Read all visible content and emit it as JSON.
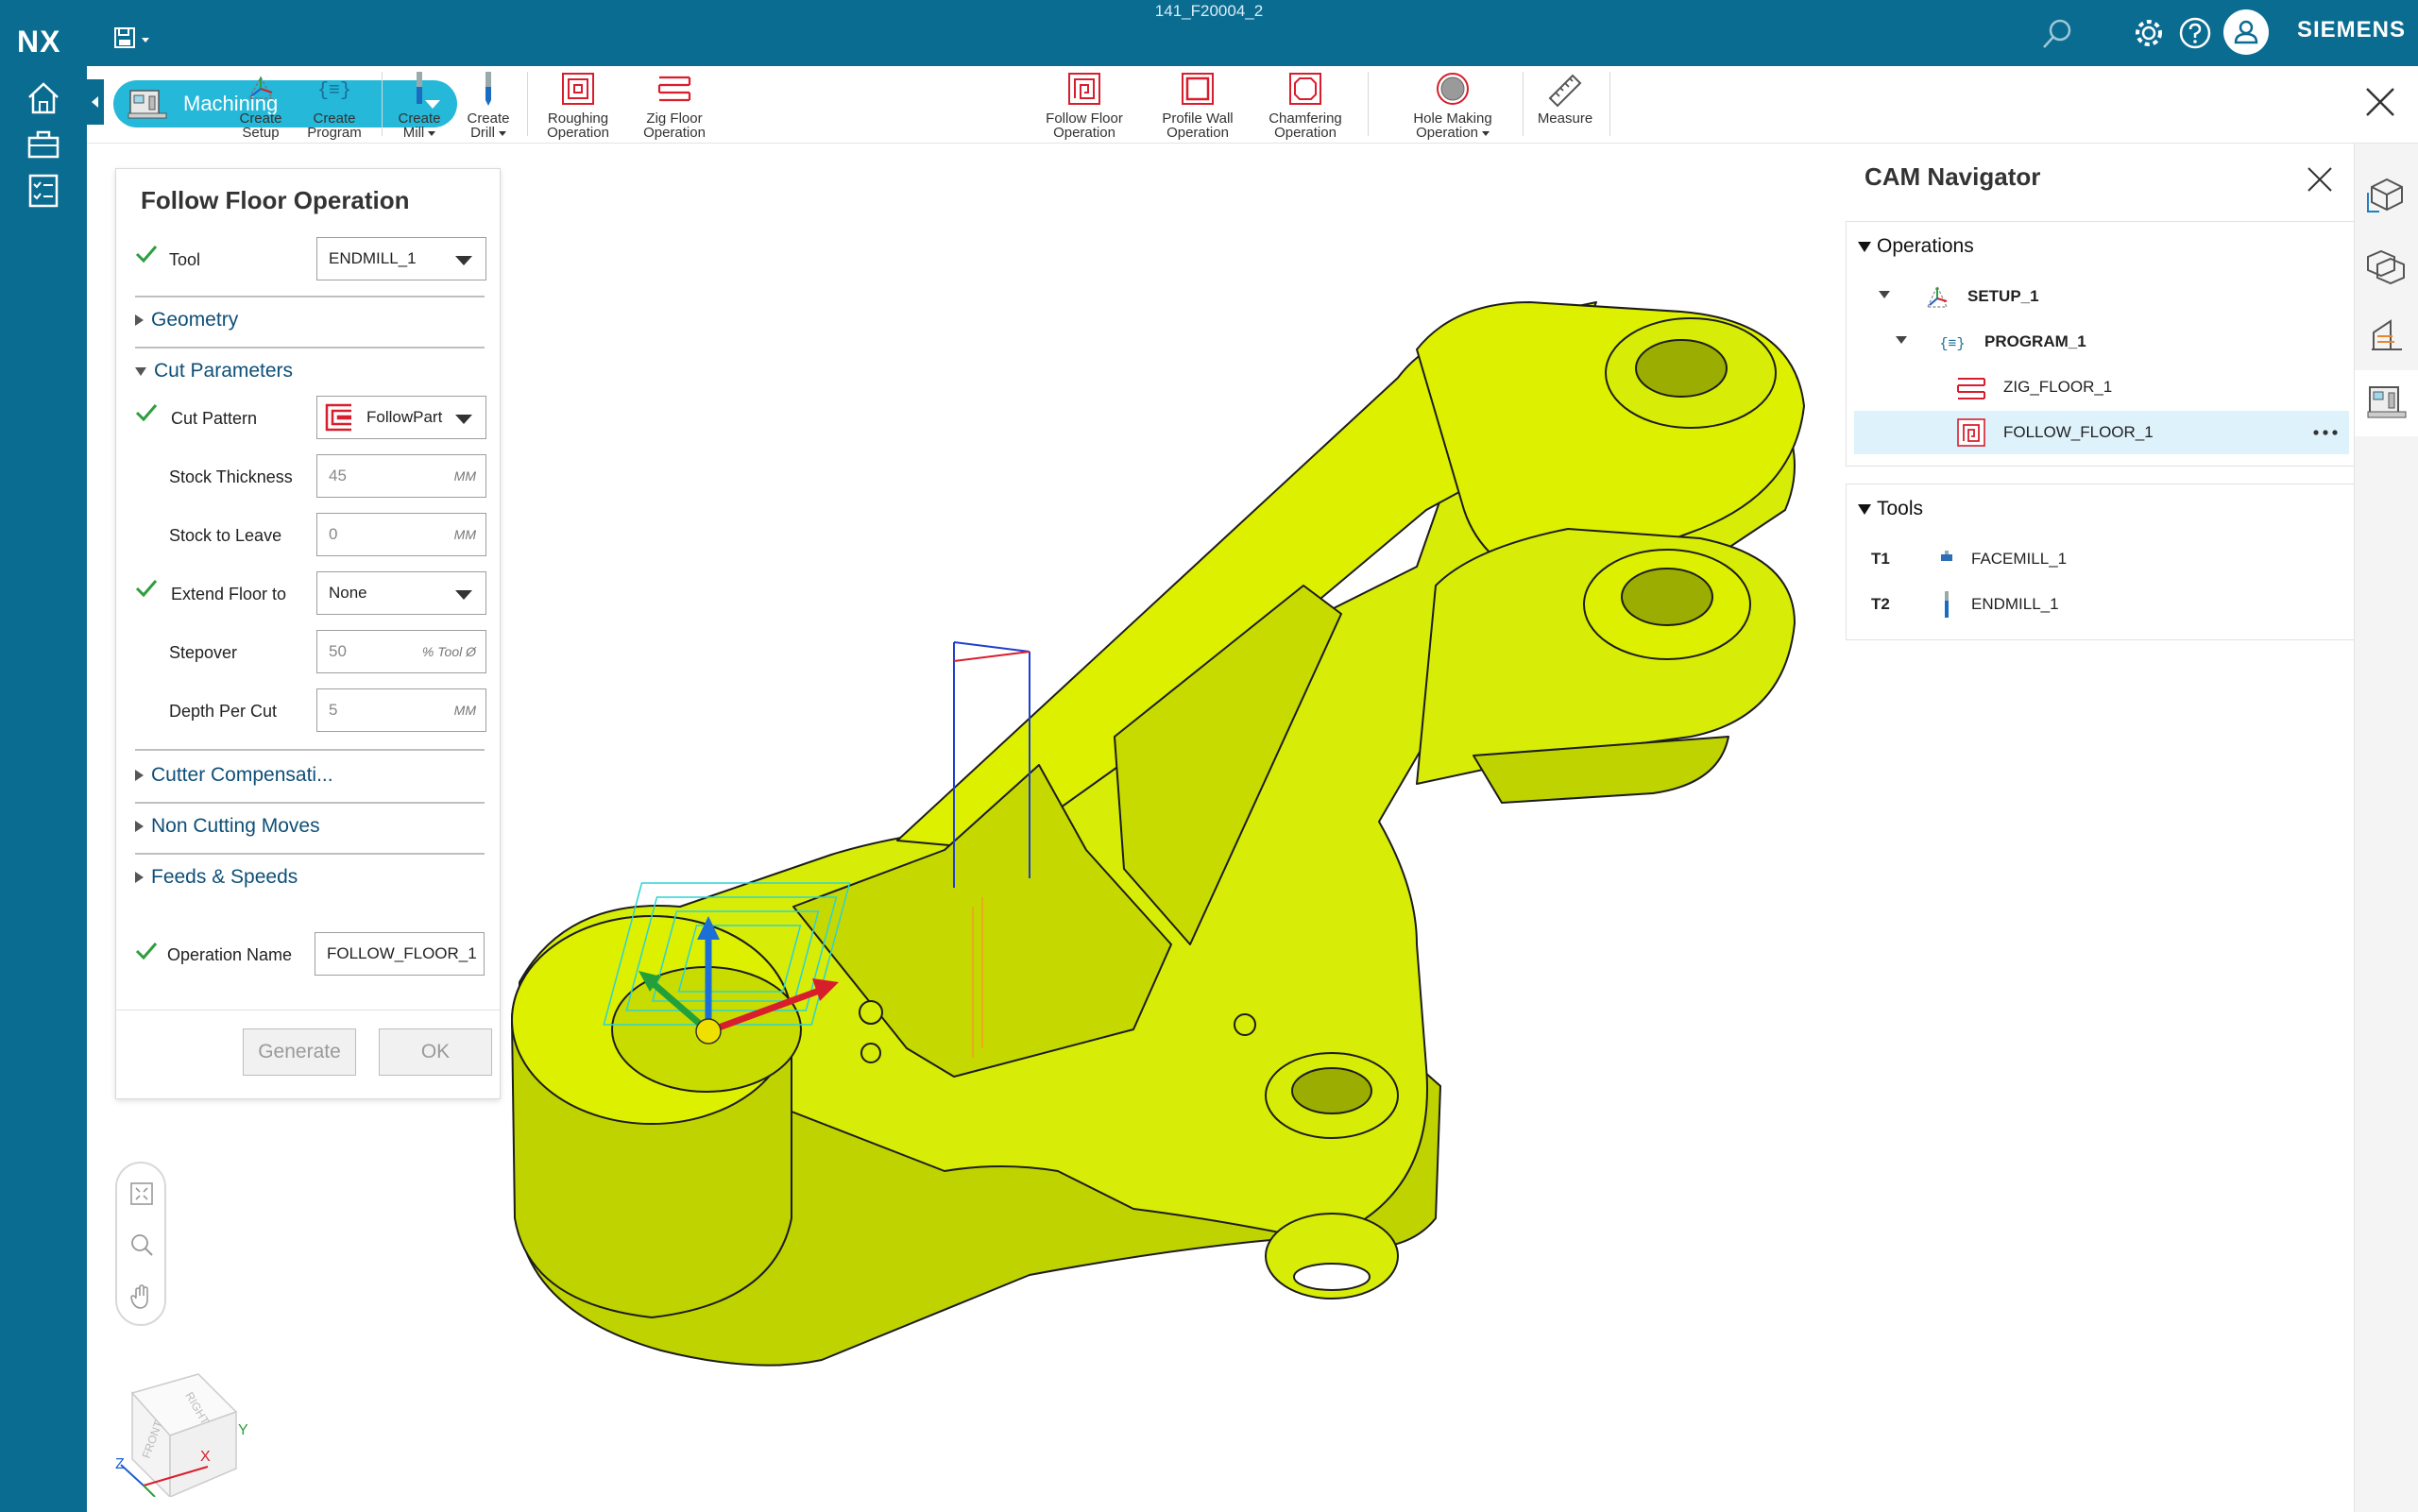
{
  "app": {
    "logo": "NX",
    "document_title": "141_F20004_2",
    "brand": "SIEMENS"
  },
  "ribbon": {
    "application": "Machining",
    "buttons": [
      {
        "line1": "Create",
        "line2": "Setup",
        "icon": "setup-icon"
      },
      {
        "line1": "Create",
        "line2": "Program",
        "icon": "program-icon"
      },
      {
        "line1": "Create",
        "line2": "Mill",
        "icon": "mill-icon",
        "dropdown": true
      },
      {
        "line1": "Create",
        "line2": "Drill",
        "icon": "drill-icon",
        "dropdown": true
      },
      {
        "line1": "Roughing",
        "line2": "Operation",
        "icon": "roughing-icon"
      },
      {
        "line1": "Zig Floor",
        "line2": "Operation",
        "icon": "zig-floor-icon"
      },
      {
        "line1": "Follow Floor",
        "line2": "Operation",
        "icon": "follow-floor-icon"
      },
      {
        "line1": "Profile Wall",
        "line2": "Operation",
        "icon": "profile-wall-icon"
      },
      {
        "line1": "Chamfering",
        "line2": "Operation",
        "icon": "chamfering-icon"
      },
      {
        "line1": "Hole Making",
        "line2": "Operation",
        "icon": "hole-making-icon",
        "dropdown": true
      },
      {
        "line1": "Measure",
        "line2": "",
        "icon": "ruler-icon"
      }
    ]
  },
  "operation_panel": {
    "title": "Follow Floor Operation",
    "tool": {
      "label": "Tool",
      "value": "ENDMILL_1"
    },
    "sections": {
      "geometry": "Geometry",
      "cut_parameters": "Cut Parameters",
      "cutter_compensation": "Cutter Compensati...",
      "non_cutting_moves": "Non Cutting Moves",
      "feeds_speeds": "Feeds & Speeds"
    },
    "cut_pattern": {
      "label": "Cut Pattern",
      "value": "FollowPart"
    },
    "stock_thickness": {
      "label": "Stock Thickness",
      "value": "45",
      "unit": "MM"
    },
    "stock_to_leave": {
      "label": "Stock to Leave",
      "value": "0",
      "unit": "MM"
    },
    "extend_floor_to": {
      "label": "Extend Floor to",
      "value": "None"
    },
    "stepover": {
      "label": "Stepover",
      "value": "50",
      "unit": "% Tool Ø"
    },
    "depth_per_cut": {
      "label": "Depth Per Cut",
      "value": "5",
      "unit": "MM"
    },
    "operation_name": {
      "label": "Operation Name",
      "value": "FOLLOW_FLOOR_1"
    },
    "buttons": {
      "generate": "Generate",
      "ok": "OK"
    }
  },
  "cam_navigator": {
    "title": "CAM Navigator",
    "operations_header": "Operations",
    "operations": [
      {
        "label": "SETUP_1",
        "level": 0,
        "bold": true
      },
      {
        "label": "PROGRAM_1",
        "level": 1,
        "bold": true
      },
      {
        "label": "ZIG_FLOOR_1",
        "level": 2,
        "bold": false
      },
      {
        "label": "FOLLOW_FLOOR_1",
        "level": 2,
        "bold": false,
        "selected": true
      }
    ],
    "tools_header": "Tools",
    "tools": [
      {
        "id": "T1",
        "name": "FACEMILL_1"
      },
      {
        "id": "T2",
        "name": "ENDMILL_1"
      }
    ]
  },
  "view_cube": {
    "front": "FRONT",
    "right": "RIGHT",
    "x": "X",
    "y": "Y",
    "z": "Z"
  },
  "colors": {
    "brand_blue": "#0b6c91",
    "accent_cyan": "#25b8d8",
    "part_yellow": "#dcf000",
    "check_green": "#2e9e3e",
    "op_red": "#d81e2c"
  }
}
